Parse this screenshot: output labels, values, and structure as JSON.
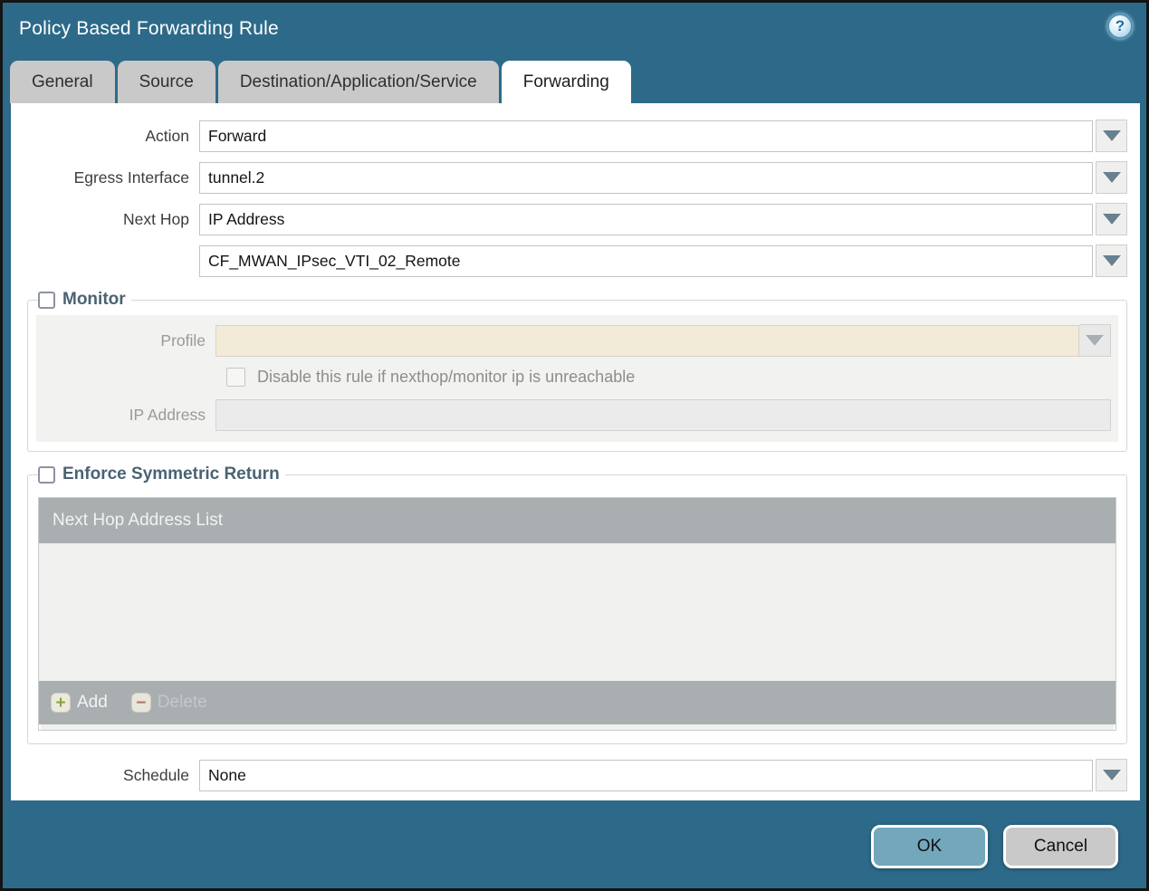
{
  "window": {
    "title": "Policy Based Forwarding Rule"
  },
  "icons": {
    "help": "?",
    "add": "+",
    "delete": "−"
  },
  "tabs": [
    {
      "label": "General",
      "active": false
    },
    {
      "label": "Source",
      "active": false
    },
    {
      "label": "Destination/Application/Service",
      "active": false
    },
    {
      "label": "Forwarding",
      "active": true
    }
  ],
  "form": {
    "action": {
      "label": "Action",
      "value": "Forward"
    },
    "egress_interface": {
      "label": "Egress Interface",
      "value": "tunnel.2"
    },
    "next_hop": {
      "label": "Next Hop",
      "value": "IP Address"
    },
    "next_hop_address": {
      "value": "CF_MWAN_IPsec_VTI_02_Remote"
    },
    "schedule": {
      "label": "Schedule",
      "value": "None"
    }
  },
  "monitor": {
    "legend": "Monitor",
    "checked": false,
    "profile": {
      "label": "Profile",
      "value": ""
    },
    "disable_rule_label": "Disable this rule if nexthop/monitor ip is unreachable",
    "disable_rule_checked": false,
    "ip_address": {
      "label": "IP Address",
      "value": ""
    }
  },
  "symmetric_return": {
    "legend": "Enforce Symmetric Return",
    "checked": false,
    "table_header": "Next Hop Address List",
    "rows": [],
    "add_label": "Add",
    "delete_label": "Delete"
  },
  "footer": {
    "ok_label": "OK",
    "cancel_label": "Cancel"
  },
  "colors": {
    "chrome_teal": "#2d6a89",
    "tab_inactive": "#c9c9c9",
    "panel_white": "#ffffff",
    "section_title": "#4a6372",
    "table_bar_grey": "#a9aeb1",
    "profile_disabled_beige": "#f1ebd8",
    "ok_button": "#73a7bc",
    "cancel_button": "#c9c9c9",
    "add_plus_green": "#8ba23e",
    "delete_minus_red": "#b0726a"
  }
}
